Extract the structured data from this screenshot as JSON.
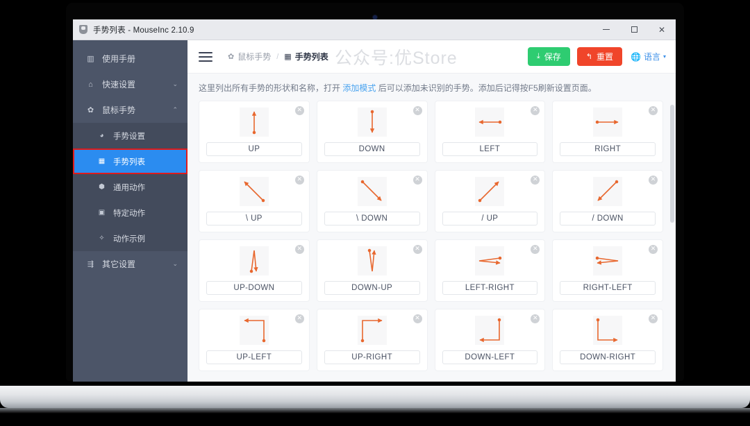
{
  "window": {
    "title": "手势列表 - MouseInc 2.10.9",
    "app_icon": "shield-icon",
    "controls": {
      "minimize": "－",
      "maximize": "□",
      "close": "✕"
    }
  },
  "sidebar": {
    "items": [
      {
        "label": "使用手册",
        "icon": "book-icon",
        "chevron": "",
        "level": "top",
        "active": false
      },
      {
        "label": "快速设置",
        "icon": "home-icon",
        "chevron": "⌄",
        "level": "top",
        "active": false
      },
      {
        "label": "鼠标手势",
        "icon": "gear-icon",
        "chevron": "⌃",
        "level": "top",
        "active": false
      },
      {
        "label": "手势设置",
        "icon": "palette-icon",
        "chevron": "",
        "level": "sub",
        "active": false
      },
      {
        "label": "手势列表",
        "icon": "grid-icon",
        "chevron": "",
        "level": "sub",
        "active": true
      },
      {
        "label": "通用动作",
        "icon": "cube-icon",
        "chevron": "",
        "level": "sub",
        "active": false
      },
      {
        "label": "特定动作",
        "icon": "camera-icon",
        "chevron": "",
        "level": "sub",
        "active": false
      },
      {
        "label": "动作示例",
        "icon": "sparkle-icon",
        "chevron": "",
        "level": "sub",
        "active": false
      },
      {
        "label": "其它设置",
        "icon": "sliders-icon",
        "chevron": "⌄",
        "level": "top",
        "active": false
      }
    ]
  },
  "toolbar": {
    "menu_icon": "hamburger-icon",
    "breadcrumb_parent": "鼠标手势",
    "breadcrumb_separator": "/",
    "breadcrumb_current": "手势列表",
    "watermark": "公众号:优Store",
    "save_label": "保存",
    "save_icon": "download-icon",
    "reset_label": "重置",
    "reset_icon": "undo-icon",
    "language_label": "语言",
    "language_icon": "globe-icon",
    "language_caret": "▾",
    "colors": {
      "save": "#2ecc71",
      "reset": "#f0452a",
      "link": "#3b8fe8",
      "active_nav": "#2b8cf0",
      "highlight": "#e01b1b"
    }
  },
  "description": {
    "prefix": "这里列出所有手势的形状和名称，打开 ",
    "link": "添加模式",
    "suffix": " 后可以添加未识别的手势。添加后记得按F5刷新设置页面。"
  },
  "gestures": {
    "close_badge": "✕",
    "items": [
      {
        "label": "UP",
        "shape": "up"
      },
      {
        "label": "DOWN",
        "shape": "down"
      },
      {
        "label": "LEFT",
        "shape": "left"
      },
      {
        "label": "RIGHT",
        "shape": "right"
      },
      {
        "label": "\\ UP",
        "shape": "bslash-up"
      },
      {
        "label": "\\ DOWN",
        "shape": "bslash-down"
      },
      {
        "label": "/ UP",
        "shape": "slash-up"
      },
      {
        "label": "/ DOWN",
        "shape": "slash-down"
      },
      {
        "label": "UP-DOWN",
        "shape": "up-down"
      },
      {
        "label": "DOWN-UP",
        "shape": "down-up"
      },
      {
        "label": "LEFT-RIGHT",
        "shape": "left-right"
      },
      {
        "label": "RIGHT-LEFT",
        "shape": "right-left"
      },
      {
        "label": "UP-LEFT",
        "shape": "up-left"
      },
      {
        "label": "UP-RIGHT",
        "shape": "up-right"
      },
      {
        "label": "DOWN-LEFT",
        "shape": "down-left"
      },
      {
        "label": "DOWN-RIGHT",
        "shape": "down-right"
      }
    ],
    "stroke_color": "#e8672e"
  }
}
